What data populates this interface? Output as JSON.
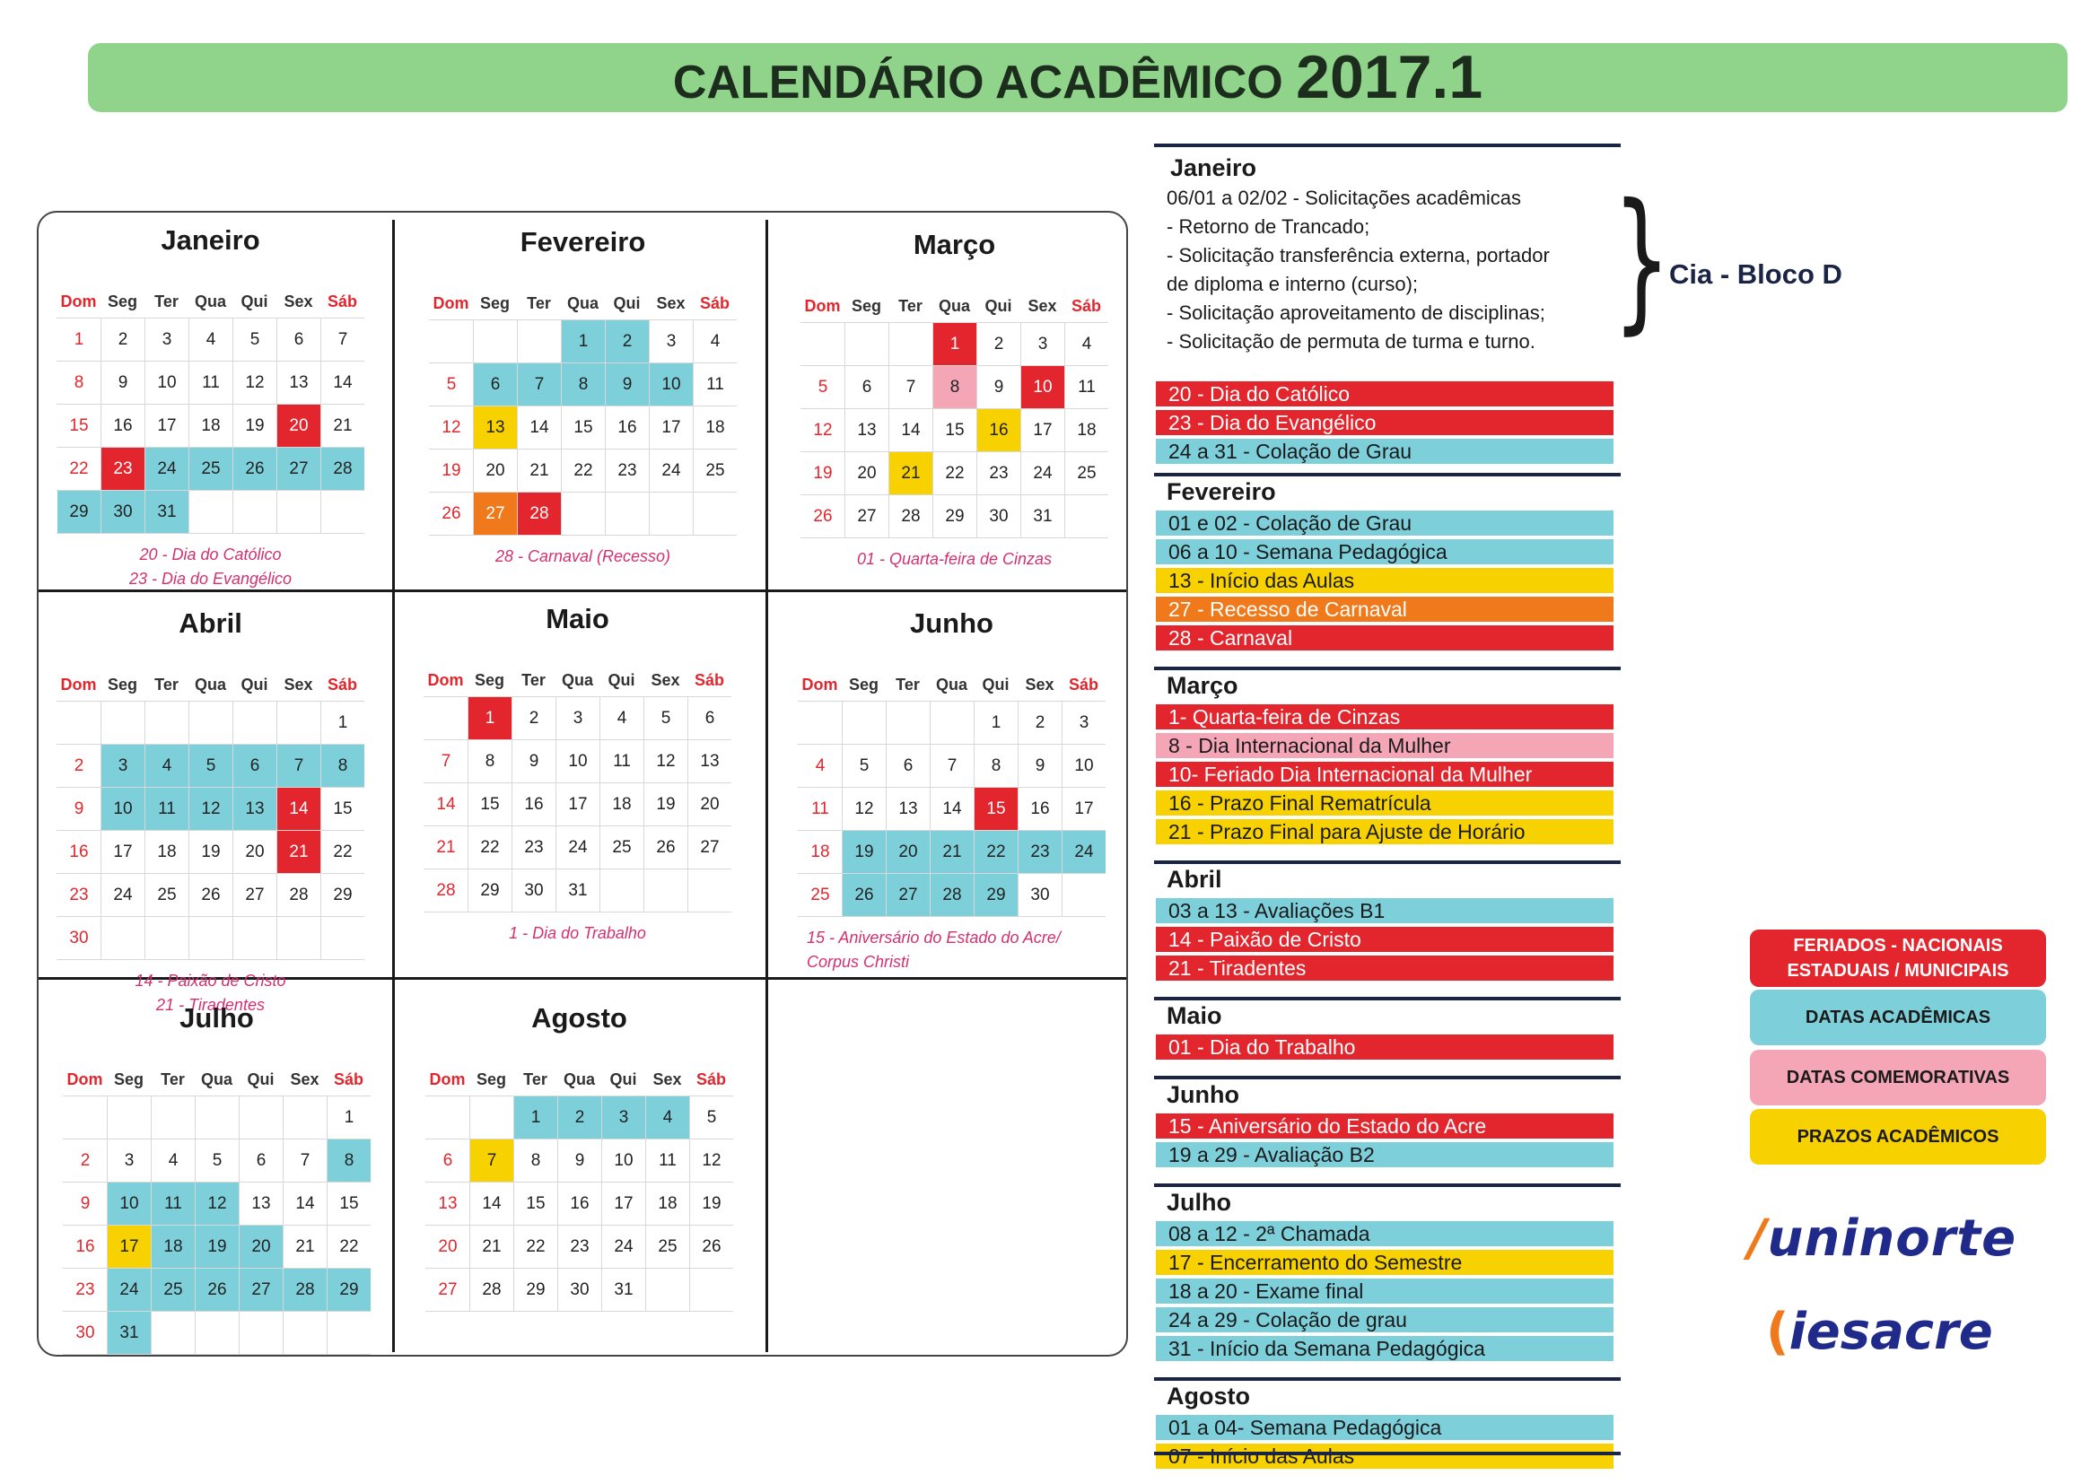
{
  "title": {
    "text": "CALENDÁRIO ACADÊMICO",
    "year": "2017.1"
  },
  "weekdays": [
    "Dom",
    "Seg",
    "Ter",
    "Qua",
    "Qui",
    "Sex",
    "Sáb"
  ],
  "months": [
    {
      "name": "Janeiro",
      "start": 0,
      "days": 31,
      "colors": {
        "20": "red",
        "23": "red",
        "24": "teal",
        "25": "teal",
        "26": "teal",
        "27": "teal",
        "28": "teal",
        "29": "teal",
        "30": "teal",
        "31": "teal"
      },
      "notes": [
        "20 - Dia do Católico",
        "23 - Dia do Evangélico"
      ]
    },
    {
      "name": "Fevereiro",
      "start": 3,
      "days": 28,
      "colors": {
        "1": "teal",
        "2": "teal",
        "6": "teal",
        "7": "teal",
        "8": "teal",
        "9": "teal",
        "10": "teal",
        "13": "yellow",
        "27": "orange",
        "28": "red"
      },
      "notes": [
        "28 - Carnaval (Recesso)"
      ]
    },
    {
      "name": "Março",
      "start": 3,
      "days": 31,
      "colors": {
        "1": "red",
        "8": "pink",
        "10": "red",
        "16": "yellow",
        "21": "yellow"
      },
      "notes": [
        "01 - Quarta-feira de Cinzas"
      ]
    },
    {
      "name": "Abril",
      "start": 6,
      "days": 30,
      "colors": {
        "3": "teal",
        "4": "teal",
        "5": "teal",
        "6": "teal",
        "7": "teal",
        "8": "teal",
        "10": "teal",
        "11": "teal",
        "12": "teal",
        "13": "teal",
        "14": "red",
        "21": "red"
      },
      "notes": [
        "14 - Paixão de Cristo",
        "21 - Tiradentes"
      ]
    },
    {
      "name": "Maio",
      "start": 1,
      "days": 31,
      "colors": {
        "1": "red"
      },
      "notes": [
        "1 - Dia do Trabalho"
      ]
    },
    {
      "name": "Junho",
      "start": 4,
      "days": 30,
      "colors": {
        "15": "red",
        "19": "teal",
        "20": "teal",
        "21": "teal",
        "22": "teal",
        "23": "teal",
        "24": "teal",
        "26": "teal",
        "27": "teal",
        "28": "teal",
        "29": "teal"
      },
      "notes": [
        "15 - Aniversário do Estado do Acre/",
        "Corpus Christi"
      ]
    },
    {
      "name": "Julho",
      "start": 6,
      "days": 31,
      "colors": {
        "8": "teal",
        "10": "teal",
        "11": "teal",
        "12": "teal",
        "17": "yellow",
        "18": "teal",
        "19": "teal",
        "20": "teal",
        "24": "teal",
        "25": "teal",
        "26": "teal",
        "27": "teal",
        "28": "teal",
        "29": "teal",
        "31": "teal"
      },
      "notes": []
    },
    {
      "name": "Agosto",
      "start": 2,
      "days": 31,
      "colors": {
        "1": "teal",
        "2": "teal",
        "3": "teal",
        "4": "teal",
        "7": "yellow"
      },
      "notes": []
    }
  ],
  "sidebar": {
    "janeiro_title": "Janeiro",
    "janeiro_lines": [
      "06/01 a 02/02 - Solicitações acadêmicas",
      "- Retorno de Trancado;",
      "- Solicitação transferência externa, portador",
      "de diploma e interno (curso);",
      "- Solicitação aproveitamento de disciplinas;",
      "- Solicitação de permuta de turma e turno."
    ],
    "cia": "Cia - Bloco D",
    "janeiro_items": [
      {
        "text": "20 - Dia do Católico",
        "color": "red"
      },
      {
        "text": "23 - Dia do Evangélico",
        "color": "red"
      },
      {
        "text": "24 a 31 - Colação de Grau",
        "color": "teal"
      }
    ],
    "sections": [
      {
        "title": "Fevereiro",
        "items": [
          {
            "text": "01 e 02 - Colação de Grau",
            "color": "teal"
          },
          {
            "text": "06 a 10 - Semana Pedagógica",
            "color": "teal"
          },
          {
            "text": "13 - Início das Aulas",
            "color": "yellow"
          },
          {
            "text": "27 - Recesso de Carnaval",
            "color": "orange"
          },
          {
            "text": "28 - Carnaval",
            "color": "red"
          }
        ]
      },
      {
        "title": "Março",
        "items": [
          {
            "text": "1- Quarta-feira de Cinzas",
            "color": "red"
          },
          {
            "text": "8 - Dia Internacional da Mulher",
            "color": "pink"
          },
          {
            "text": "10- Feriado Dia Internacional da Mulher",
            "color": "red"
          },
          {
            "text": "16 - Prazo Final Rematrícula",
            "color": "yellow"
          },
          {
            "text": "21 - Prazo Final para Ajuste de Horário",
            "color": "yellow"
          }
        ]
      },
      {
        "title": "Abril",
        "items": [
          {
            "text": "03 a 13 - Avaliações B1",
            "color": "teal"
          },
          {
            "text": "14 - Paixão de Cristo",
            "color": "red"
          },
          {
            "text": "21 - Tiradentes",
            "color": "red"
          }
        ]
      },
      {
        "title": "Maio",
        "items": [
          {
            "text": "01 - Dia do Trabalho",
            "color": "red"
          }
        ]
      },
      {
        "title": "Junho",
        "items": [
          {
            "text": "15 - Aniversário do Estado do Acre",
            "color": "red"
          },
          {
            "text": "19 a 29 - Avaliação B2",
            "color": "teal"
          }
        ]
      },
      {
        "title": "Julho",
        "items": [
          {
            "text": "08 a 12 - 2ª Chamada",
            "color": "teal"
          },
          {
            "text": "17 - Encerramento do Semestre",
            "color": "yellow"
          },
          {
            "text": "18 a 20 - Exame final",
            "color": "teal"
          },
          {
            "text": "24 a 29 - Colação de grau",
            "color": "teal"
          },
          {
            "text": "31 - Início da Semana Pedagógica",
            "color": "teal"
          }
        ]
      },
      {
        "title": "Agosto",
        "items": [
          {
            "text": "01 a 04- Semana Pedagógica",
            "color": "teal"
          },
          {
            "text": "07 - Início das Aulas",
            "color": "yellow"
          }
        ]
      }
    ]
  },
  "legend": [
    {
      "text": "FERIADOS - NACIONAIS ESTADUAIS / MUNICIPAIS",
      "color": "#e3262d",
      "fg": "#ffffff"
    },
    {
      "text": "DATAS ACADÊMICAS",
      "color": "#7dcfda",
      "fg": "#1a1a1a"
    },
    {
      "text": "DATAS COMEMORATIVAS",
      "color": "#f4a5b6",
      "fg": "#1a1a1a"
    },
    {
      "text": "PRAZOS ACADÊMICOS",
      "color": "#f7d100",
      "fg": "#1a1a1a"
    }
  ],
  "logos": {
    "uninorte": "uninorte",
    "iesacre": "iesacre"
  }
}
